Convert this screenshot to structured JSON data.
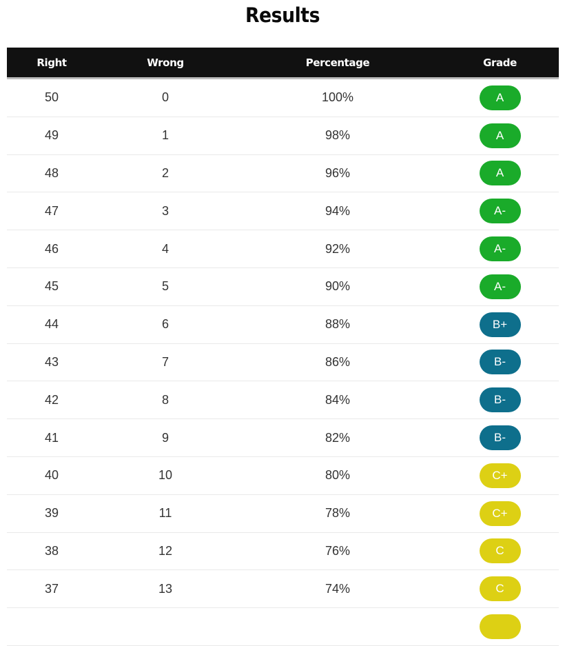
{
  "page": {
    "title": "Results"
  },
  "table": {
    "headers": {
      "right": "Right",
      "wrong": "Wrong",
      "percentage": "Percentage",
      "grade": "Grade"
    },
    "grade_colors": {
      "A": "#1aab2a",
      "B": "#0e6f8c",
      "C": "#ddd014"
    },
    "rows": [
      {
        "right": "50",
        "wrong": "0",
        "percentage": "100%",
        "grade": "A",
        "grade_band": "A"
      },
      {
        "right": "49",
        "wrong": "1",
        "percentage": "98%",
        "grade": "A",
        "grade_band": "A"
      },
      {
        "right": "48",
        "wrong": "2",
        "percentage": "96%",
        "grade": "A",
        "grade_band": "A"
      },
      {
        "right": "47",
        "wrong": "3",
        "percentage": "94%",
        "grade": "A-",
        "grade_band": "A"
      },
      {
        "right": "46",
        "wrong": "4",
        "percentage": "92%",
        "grade": "A-",
        "grade_band": "A"
      },
      {
        "right": "45",
        "wrong": "5",
        "percentage": "90%",
        "grade": "A-",
        "grade_band": "A"
      },
      {
        "right": "44",
        "wrong": "6",
        "percentage": "88%",
        "grade": "B+",
        "grade_band": "B"
      },
      {
        "right": "43",
        "wrong": "7",
        "percentage": "86%",
        "grade": "B-",
        "grade_band": "B"
      },
      {
        "right": "42",
        "wrong": "8",
        "percentage": "84%",
        "grade": "B-",
        "grade_band": "B"
      },
      {
        "right": "41",
        "wrong": "9",
        "percentage": "82%",
        "grade": "B-",
        "grade_band": "B"
      },
      {
        "right": "40",
        "wrong": "10",
        "percentage": "80%",
        "grade": "C+",
        "grade_band": "C"
      },
      {
        "right": "39",
        "wrong": "11",
        "percentage": "78%",
        "grade": "C+",
        "grade_band": "C"
      },
      {
        "right": "38",
        "wrong": "12",
        "percentage": "76%",
        "grade": "C",
        "grade_band": "C"
      },
      {
        "right": "37",
        "wrong": "13",
        "percentage": "74%",
        "grade": "C",
        "grade_band": "C"
      },
      {
        "right": "",
        "wrong": "",
        "percentage": "",
        "grade": "",
        "grade_band": "C"
      }
    ]
  }
}
